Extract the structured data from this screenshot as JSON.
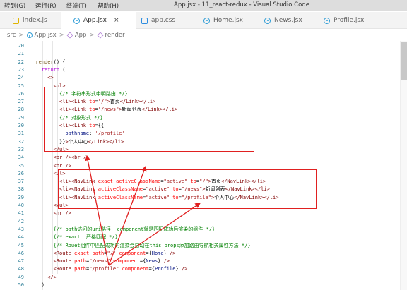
{
  "menu": [
    {
      "label": "转到(G)"
    },
    {
      "label": "运行(R)"
    },
    {
      "label": "终端(T)"
    },
    {
      "label": "帮助(H)"
    }
  ],
  "window_title": "App.jsx - 11_react-redux - Visual Studio Code",
  "tabs": [
    {
      "label": "index.js",
      "icon": "js-icon",
      "active": false
    },
    {
      "label": "App.jsx",
      "icon": "react-icon",
      "active": true,
      "close": "×"
    },
    {
      "label": "app.css",
      "icon": "css-icon",
      "active": false
    },
    {
      "label": "Home.jsx",
      "icon": "react-icon",
      "active": false
    },
    {
      "label": "News.jsx",
      "icon": "react-icon",
      "active": false
    },
    {
      "label": "Profile.jsx",
      "icon": "react-icon",
      "active": false
    }
  ],
  "breadcrumb": {
    "items": [
      "src",
      "App.jsx",
      "App",
      "render"
    ],
    "separator": ">"
  },
  "colors": {
    "annotation": "#e02020",
    "line_number": "#237893",
    "keyword": "#0000ff",
    "tag": "#800000",
    "attribute": "#ff0000",
    "string": "#a31515",
    "comment": "#008000"
  },
  "code_lines": [
    {
      "n": "20",
      "indent": 0,
      "tokens": [
        [
          "txt",
          ""
        ]
      ]
    },
    {
      "n": "21",
      "indent": 0,
      "tokens": [
        [
          "txt",
          ""
        ]
      ]
    },
    {
      "n": "22",
      "indent": 2,
      "tokens": [
        [
          "fn",
          "render"
        ],
        [
          "txt",
          "() {"
        ]
      ]
    },
    {
      "n": "23",
      "indent": 4,
      "tokens": [
        [
          "ctrl",
          "return"
        ],
        [
          "txt",
          " ("
        ]
      ]
    },
    {
      "n": "24",
      "indent": 6,
      "tokens": [
        [
          "tag",
          "<>"
        ]
      ]
    },
    {
      "n": "25",
      "indent": 8,
      "tokens": [
        [
          "tag",
          "<ul>"
        ]
      ]
    },
    {
      "n": "26",
      "indent": 10,
      "tokens": [
        [
          "com",
          "{/* 字符串形式申明路由 */}"
        ]
      ]
    },
    {
      "n": "27",
      "indent": 10,
      "tokens": [
        [
          "tag",
          "<li><Link"
        ],
        [
          "txt",
          " "
        ],
        [
          "attr",
          "to"
        ],
        [
          "txt",
          "="
        ],
        [
          "str",
          "\"/\""
        ],
        [
          "tag",
          ">"
        ],
        [
          "txt",
          "首页"
        ],
        [
          "tag",
          "</Link></li>"
        ]
      ]
    },
    {
      "n": "28",
      "indent": 10,
      "tokens": [
        [
          "tag",
          "<li><Link"
        ],
        [
          "txt",
          " "
        ],
        [
          "attr",
          "to"
        ],
        [
          "txt",
          "="
        ],
        [
          "str",
          "\"/news\""
        ],
        [
          "tag",
          ">"
        ],
        [
          "txt",
          "新闻列表"
        ],
        [
          "tag",
          "</Link></li>"
        ]
      ]
    },
    {
      "n": "29",
      "indent": 10,
      "tokens": [
        [
          "com",
          "{/* 对象形式 */}"
        ]
      ]
    },
    {
      "n": "30",
      "indent": 10,
      "tokens": [
        [
          "tag",
          "<li><Link"
        ],
        [
          "txt",
          " "
        ],
        [
          "attr",
          "to"
        ],
        [
          "txt",
          "={{"
        ]
      ]
    },
    {
      "n": "31",
      "indent": 12,
      "tokens": [
        [
          "var",
          "pathname"
        ],
        [
          "txt",
          ": "
        ],
        [
          "str",
          "'/profile'"
        ]
      ]
    },
    {
      "n": "32",
      "indent": 10,
      "tokens": [
        [
          "txt",
          "}}"
        ],
        [
          "tag",
          ">"
        ],
        [
          "txt",
          "个人中心"
        ],
        [
          "tag",
          "</Link></li>"
        ]
      ]
    },
    {
      "n": "33",
      "indent": 8,
      "tokens": [
        [
          "tag",
          "</ul>"
        ]
      ]
    },
    {
      "n": "34",
      "indent": 8,
      "tokens": [
        [
          "tag",
          "<br />"
        ],
        [
          "tag",
          "<br />"
        ]
      ]
    },
    {
      "n": "35",
      "indent": 8,
      "tokens": [
        [
          "tag",
          "<br />"
        ]
      ]
    },
    {
      "n": "36",
      "indent": 8,
      "tokens": [
        [
          "tag",
          "<ul>"
        ]
      ]
    },
    {
      "n": "37",
      "indent": 10,
      "tokens": [
        [
          "tag",
          "<li><NavLink"
        ],
        [
          "txt",
          " "
        ],
        [
          "attr",
          "exact"
        ],
        [
          "txt",
          " "
        ],
        [
          "attr",
          "activeClassName"
        ],
        [
          "txt",
          "="
        ],
        [
          "str",
          "\"active\""
        ],
        [
          "txt",
          " "
        ],
        [
          "attr",
          "to"
        ],
        [
          "txt",
          "="
        ],
        [
          "str",
          "\"/\""
        ],
        [
          "tag",
          ">"
        ],
        [
          "txt",
          "首页"
        ],
        [
          "tag",
          "</NavLink></li>"
        ]
      ]
    },
    {
      "n": "38",
      "indent": 10,
      "tokens": [
        [
          "tag",
          "<li><NavLink"
        ],
        [
          "txt",
          " "
        ],
        [
          "attr",
          "activeClassName"
        ],
        [
          "txt",
          "="
        ],
        [
          "str",
          "\"active\""
        ],
        [
          "txt",
          " "
        ],
        [
          "attr",
          "to"
        ],
        [
          "txt",
          "="
        ],
        [
          "str",
          "\"/news\""
        ],
        [
          "tag",
          ">"
        ],
        [
          "txt",
          "新闻列表"
        ],
        [
          "tag",
          "</NavLink></li>"
        ]
      ]
    },
    {
      "n": "39",
      "indent": 10,
      "tokens": [
        [
          "tag",
          "<li><NavLink"
        ],
        [
          "txt",
          " "
        ],
        [
          "attr",
          "activeClassName"
        ],
        [
          "txt",
          "="
        ],
        [
          "str",
          "\"active\""
        ],
        [
          "txt",
          " "
        ],
        [
          "attr",
          "to"
        ],
        [
          "txt",
          "="
        ],
        [
          "str",
          "\"/profile\""
        ],
        [
          "tag",
          ">"
        ],
        [
          "txt",
          "个人中心"
        ],
        [
          "tag",
          "</NavLink></li>"
        ]
      ]
    },
    {
      "n": "40",
      "indent": 8,
      "tokens": [
        [
          "tag",
          "</ul>"
        ]
      ]
    },
    {
      "n": "41",
      "indent": 8,
      "tokens": [
        [
          "tag",
          "<hr />"
        ]
      ]
    },
    {
      "n": "42",
      "indent": 0,
      "tokens": [
        [
          "txt",
          ""
        ]
      ]
    },
    {
      "n": "43",
      "indent": 8,
      "tokens": [
        [
          "com",
          "{/* path访问的uri路径  component就是匹配成功后渲染的组件 */}"
        ]
      ]
    },
    {
      "n": "44",
      "indent": 8,
      "tokens": [
        [
          "com",
          "{/* exact  严格匹配 */}"
        ]
      ]
    },
    {
      "n": "45",
      "indent": 8,
      "tokens": [
        [
          "com",
          "{/* Rouet组件中匹配成功的渲染会自动在this.props添加路由导航相关属性方法 */}"
        ]
      ]
    },
    {
      "n": "46",
      "indent": 8,
      "tokens": [
        [
          "tag",
          "<Route"
        ],
        [
          "txt",
          " "
        ],
        [
          "attr",
          "exact"
        ],
        [
          "txt",
          " "
        ],
        [
          "attr",
          "path"
        ],
        [
          "txt",
          "="
        ],
        [
          "str",
          "\"/\""
        ],
        [
          "txt",
          " "
        ],
        [
          "attr",
          "component"
        ],
        [
          "txt",
          "={"
        ],
        [
          "var",
          "Home"
        ],
        [
          "txt",
          "} "
        ],
        [
          "tag",
          "/>"
        ]
      ]
    },
    {
      "n": "47",
      "indent": 8,
      "tokens": [
        [
          "tag",
          "<Route"
        ],
        [
          "txt",
          " "
        ],
        [
          "attr",
          "path"
        ],
        [
          "txt",
          "="
        ],
        [
          "str",
          "\"/news\""
        ],
        [
          "txt",
          " "
        ],
        [
          "attr",
          "component"
        ],
        [
          "txt",
          "={"
        ],
        [
          "var",
          "News"
        ],
        [
          "txt",
          "} "
        ],
        [
          "tag",
          "/>"
        ]
      ]
    },
    {
      "n": "48",
      "indent": 8,
      "tokens": [
        [
          "tag",
          "<Route"
        ],
        [
          "txt",
          " "
        ],
        [
          "attr",
          "path"
        ],
        [
          "txt",
          "="
        ],
        [
          "str",
          "\"/profile\""
        ],
        [
          "txt",
          " "
        ],
        [
          "attr",
          "component"
        ],
        [
          "txt",
          "={"
        ],
        [
          "var",
          "Profile"
        ],
        [
          "txt",
          "} "
        ],
        [
          "tag",
          "/>"
        ]
      ]
    },
    {
      "n": "49",
      "indent": 6,
      "tokens": [
        [
          "tag",
          "</>"
        ]
      ]
    },
    {
      "n": "50",
      "indent": 4,
      "tokens": [
        [
          "txt",
          ")"
        ]
      ]
    },
    {
      "n": "51",
      "indent": 2,
      "tokens": [
        [
          "txt",
          "}"
        ]
      ]
    }
  ]
}
